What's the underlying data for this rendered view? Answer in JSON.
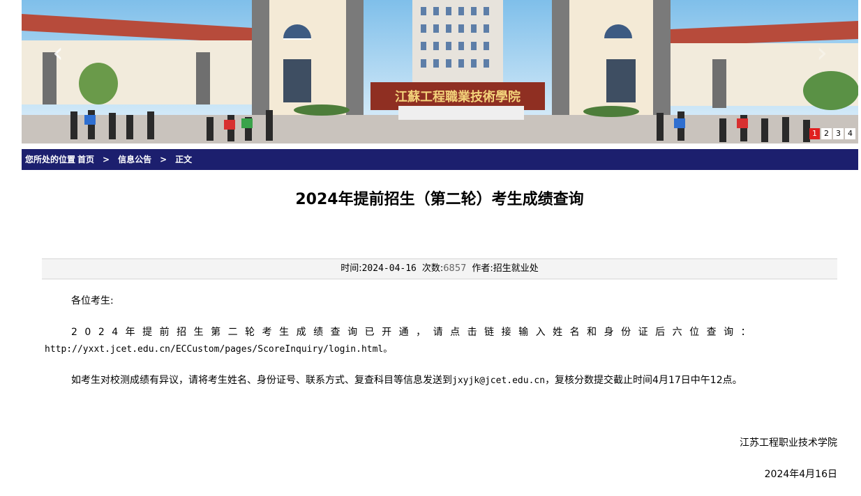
{
  "banner": {
    "sign_text": "江蘇工程職業技術學院",
    "pager": [
      "1",
      "2",
      "3",
      "4"
    ],
    "active_page": "1",
    "prev_label": "‹",
    "next_label": "›"
  },
  "breadcrumb": {
    "prefix": "您所处的位置",
    "home": "首页",
    "separator": ">",
    "section": "信息公告",
    "current": "正文"
  },
  "article": {
    "title": "2024年提前招生（第二轮）考生成绩查询",
    "meta": {
      "time_label": "时间:",
      "time_value": "2024-04-16",
      "views_label": "次数:",
      "views_value": "6857",
      "author_label": "作者:",
      "author_value": "招生就业处"
    },
    "greeting": "各位考生:",
    "para1": "2024年提前招生第二轮考生成绩查询已开通，请点击链接输入姓名和身份证后六位查询：",
    "link": "http://yxxt.jcet.edu.cn/ECCustom/pages/ScoreInquiry/login.html。",
    "para2_start": "如考生对校测成绩有异议，请将考生姓名、身份证号、联系方式、复查科目等信息发送到",
    "email": "jxyjk@jcet.edu.cn",
    "para2_end": "，复核分数提交截止时间4月17日中午12点。",
    "signature": "江苏工程职业技术学院",
    "date": "2024年4月16日"
  },
  "colors": {
    "breadcrumb_bg": "#1c1f6e",
    "pager_active": "#e02020",
    "meta_bg": "#f4f4f4"
  }
}
